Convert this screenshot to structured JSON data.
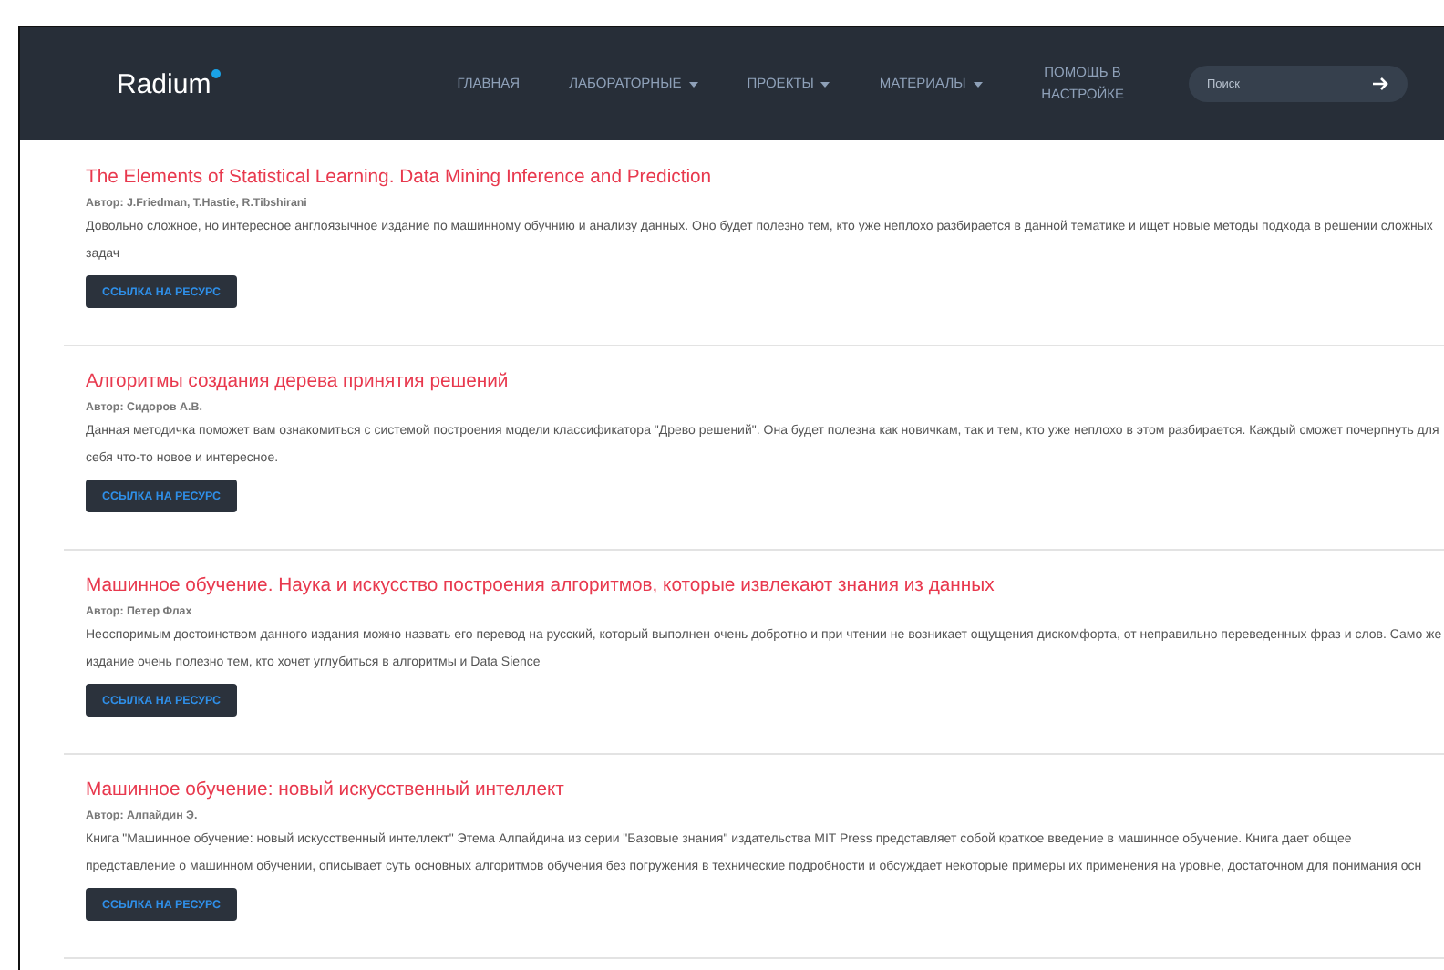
{
  "header": {
    "logo": "Radium",
    "nav": [
      {
        "label": "ГЛАВНАЯ",
        "dropdown": false
      },
      {
        "label": "ЛАБОРАТОРНЫЕ",
        "dropdown": true
      },
      {
        "label": "ПРОЕКТЫ",
        "dropdown": true
      },
      {
        "label": "МАТЕРИАЛЫ",
        "dropdown": true
      },
      {
        "label": "ПОМОЩЬ В НАСТРОЙКЕ",
        "dropdown": false
      }
    ],
    "search": {
      "placeholder": "Поиск"
    }
  },
  "entries": [
    {
      "title": "The Elements of Statistical Learning. Data Mining Inference and Prediction",
      "author": "Автор: J.Friedman, T.Hastie, R.Tibshirani",
      "description": "Довольно сложное, но интересное англоязычное издание по машинному обучнию и анализу данных. Оно будет полезно тем, кто уже неплохо разбирается в данной тематике и ищет новые методы подхода в решении сложных задач",
      "button": "ССЫЛКА НА РЕСУРС"
    },
    {
      "title": "Алгоритмы создания дерева принятия решений",
      "author": "Автор: Сидоров А.В.",
      "description": "Данная методичка поможет вам ознакомиться с системой построения модели классификатора \"Древо решений\". Она будет полезна как новичкам, так и тем, кто уже неплохо в этом разбирается. Каждый сможет почерпнуть для себя что-то новое и интересное.",
      "button": "ССЫЛКА НА РЕСУРС"
    },
    {
      "title": "Машинное обучение. Наука и искусство построения алгоритмов, которые извлекают знания из данных",
      "author": "Автор: Петер Флах",
      "description": "Неоспоримым достоинством данного издания можно назвать его перевод на русский, который выполнен очень добротно и при чтении не возникает ощущения дискомфорта, от неправильно переведенных фраз и слов. Само же издание очень полезно тем, кто хочет углубиться в алгоритмы и Data Sience",
      "button": "ССЫЛКА НА РЕСУРС"
    },
    {
      "title": "Машинное обучение: новый искусственный интеллект",
      "author": "Автор: Алпайдин Э.",
      "description": "Книга \"Машинное обучение: новый искусственный интеллект\" Этема Алпайдина из серии \"Базовые знания\" издательства MIT Press представляет собой краткое введение в машинное обучение. Книга дает общее представление о машинном обучении, описывает суть основных алгоритмов обучения без погружения в технические подробности и обсуждает некоторые примеры их применения на уровне, достаточном для понимания осн",
      "button": "ССЫЛКА НА РЕСУРС"
    }
  ]
}
